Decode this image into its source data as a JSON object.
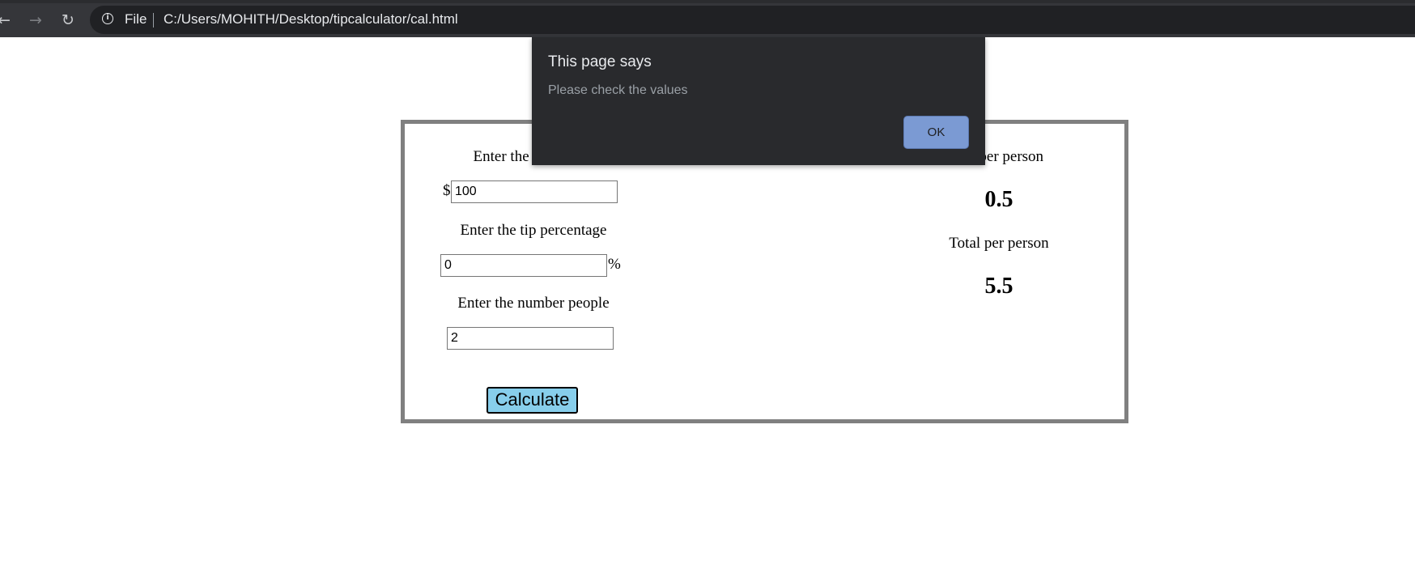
{
  "browser": {
    "back_icon": "←",
    "forward_icon": "→",
    "reload_icon": "↻",
    "info_icon": "i",
    "scheme_label": "File",
    "url": "C:/Users/MOHITH/Desktop/tipcalculator/cal.html"
  },
  "calculator": {
    "bill_label": "Enter the bill amount",
    "bill_prefix": "$",
    "bill_value": "100",
    "tip_label": "Enter the tip percentage",
    "tip_value": "0",
    "tip_suffix": "%",
    "people_label": "Enter the number people",
    "people_value": "2",
    "calculate_label": "Calculate",
    "tip_per_person_label": "Tip per person",
    "tip_per_person_value": "0.5",
    "total_per_person_label": "Total per person",
    "total_per_person_value": "5.5"
  },
  "dialog": {
    "title": "This page says",
    "message": "Please check the values",
    "ok_label": "OK"
  },
  "colors": {
    "chrome_toolbar": "#35363a",
    "omnibox": "#202124",
    "dialog_bg": "#292a2d",
    "ok_button": "#7b9ad3",
    "calculate_button": "#87ceeb",
    "calculator_border": "#808080"
  }
}
